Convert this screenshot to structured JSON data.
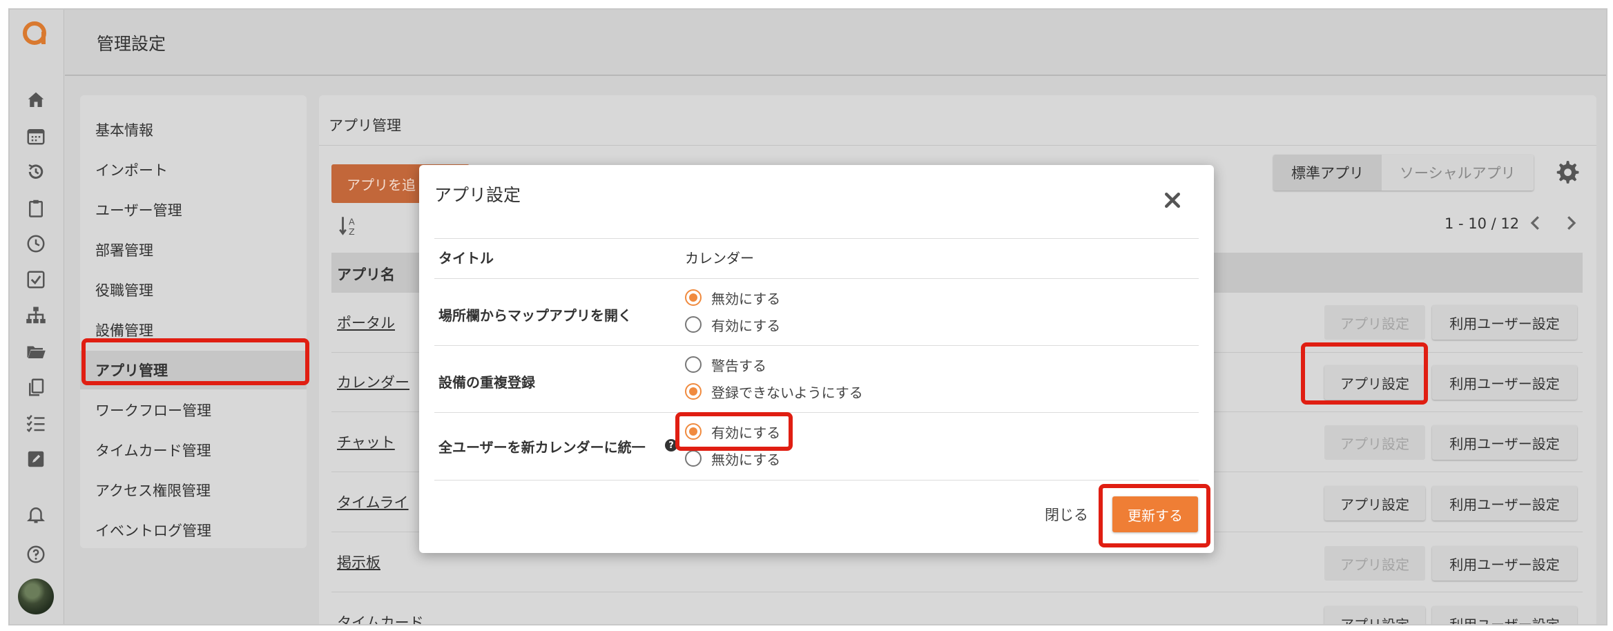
{
  "header": {
    "title": "管理設定"
  },
  "colors": {
    "accent": "#ef7e35",
    "highlight": "#e01e12",
    "overlay": "#d0d0d0"
  },
  "rail": {
    "icons": [
      "logo-icon",
      "home-icon",
      "calendar-icon",
      "history-icon",
      "clipboard-icon",
      "clock-icon",
      "checkbox-icon",
      "org-chart-icon",
      "folder-icon",
      "copy-icon",
      "checklist-icon",
      "edit-icon",
      "bell-icon",
      "help-circle-icon"
    ]
  },
  "menu": {
    "items": [
      {
        "label": "基本情報"
      },
      {
        "label": "インポート"
      },
      {
        "label": "ユーザー管理"
      },
      {
        "label": "部署管理"
      },
      {
        "label": "役職管理"
      },
      {
        "label": "設備管理"
      },
      {
        "label": "アプリ管理"
      },
      {
        "label": "ワークフロー管理"
      },
      {
        "label": "タイムカード管理"
      },
      {
        "label": "アクセス権限管理"
      },
      {
        "label": "イベントログ管理"
      }
    ],
    "active_index": 6
  },
  "main": {
    "title": "アプリ管理",
    "add_button": "アプリを追",
    "tabs": {
      "standard": "標準アプリ",
      "social": "ソーシャルアプリ"
    },
    "pager": "1 - 10 / 12",
    "column_header": "アプリ名",
    "rows": [
      {
        "name": "ポータル",
        "app_settings": "アプリ設定",
        "user_settings": "利用ユーザー設定",
        "app_disabled": true
      },
      {
        "name": "カレンダー",
        "app_settings": "アプリ設定",
        "user_settings": "利用ユーザー設定",
        "app_disabled": false
      },
      {
        "name": "チャット",
        "app_settings": "アプリ設定",
        "user_settings": "利用ユーザー設定",
        "app_disabled": true
      },
      {
        "name": "タイムライ",
        "app_settings": "アプリ設定",
        "user_settings": "利用ユーザー設定",
        "app_disabled": false
      },
      {
        "name": "掲示板",
        "app_settings": "アプリ設定",
        "user_settings": "利用ユーザー設定",
        "app_disabled": true
      },
      {
        "name": "タイムカード",
        "app_settings": "アプリ設定",
        "user_settings": "利用ユーザー設定",
        "app_disabled": false
      }
    ]
  },
  "modal": {
    "title": "アプリ設定",
    "title_label": "タイトル",
    "title_value": "カレンダー",
    "map_label": "場所欄からマップアプリを開く",
    "map_opt1": "無効にする",
    "map_opt2": "有効にする",
    "dup_label": "設備の重複登録",
    "dup_opt1": "警告する",
    "dup_opt2": "登録できないようにする",
    "unify_label": "全ユーザーを新カレンダーに統一",
    "unify_opt1": "有効にする",
    "unify_opt2": "無効にする",
    "help_glyph": "?",
    "close_label": "閉じる",
    "update_label": "更新する"
  }
}
